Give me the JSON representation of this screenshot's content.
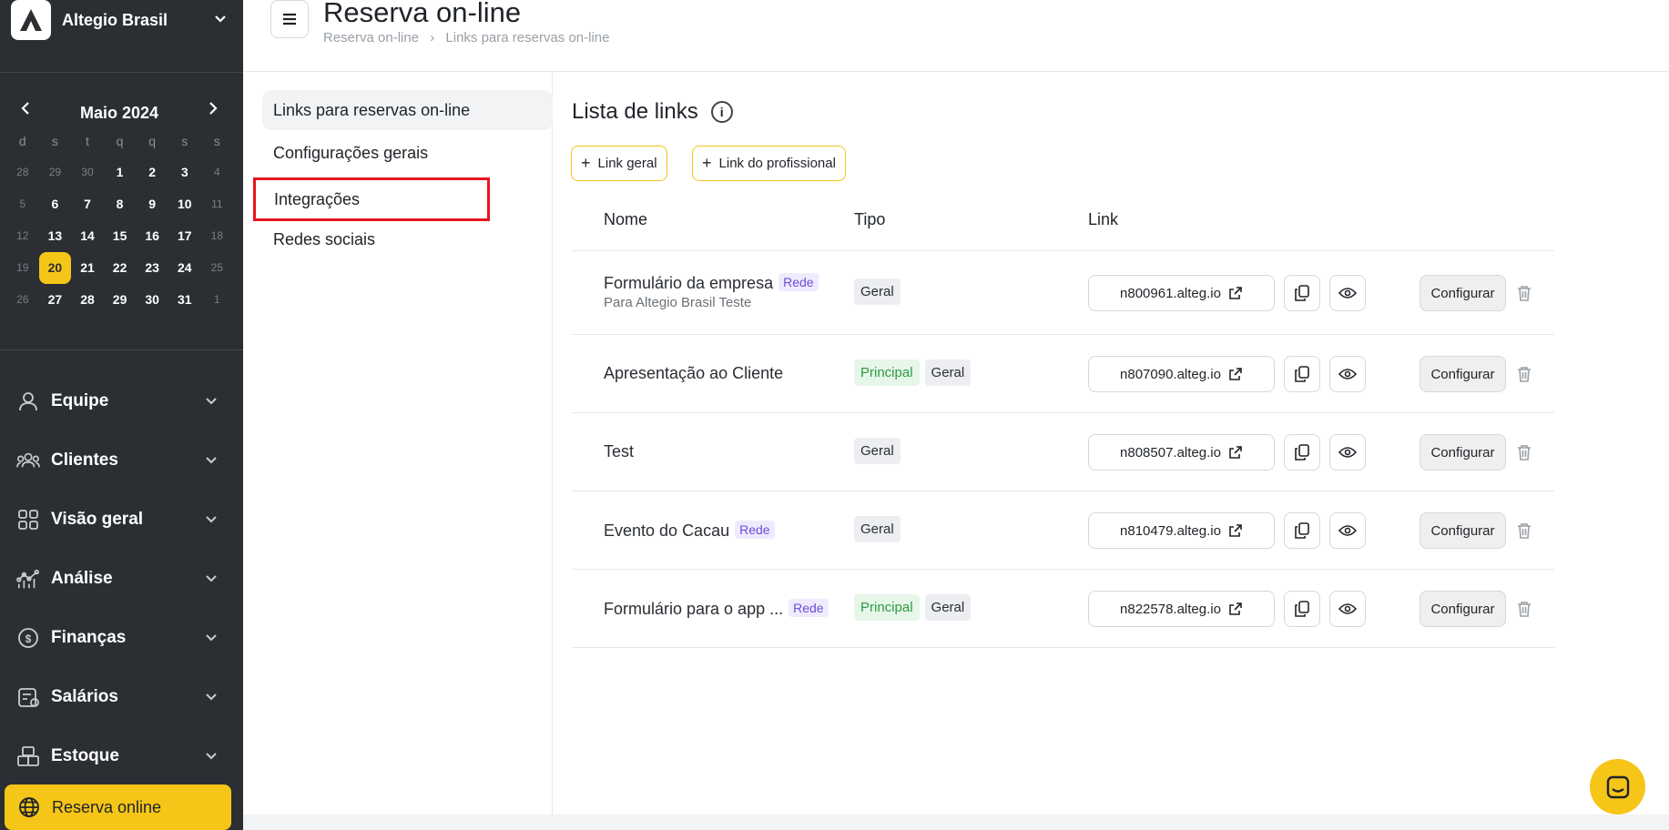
{
  "company": {
    "name": "Altegio Brasil",
    "logo_icon": "altegio-logo"
  },
  "calendar": {
    "title": "Maio 2024",
    "weekdays": [
      "d",
      "s",
      "t",
      "q",
      "q",
      "s",
      "s"
    ],
    "weeks": [
      [
        "28",
        "29",
        "30",
        "1",
        "2",
        "3",
        "4"
      ],
      [
        "5",
        "6",
        "7",
        "8",
        "9",
        "10",
        "11"
      ],
      [
        "12",
        "13",
        "14",
        "15",
        "16",
        "17",
        "18"
      ],
      [
        "19",
        "20",
        "21",
        "22",
        "23",
        "24",
        "25"
      ],
      [
        "26",
        "27",
        "28",
        "29",
        "30",
        "31",
        "1"
      ]
    ],
    "today": "20"
  },
  "nav": {
    "items": [
      {
        "label": "Equipe",
        "icon": "user-icon"
      },
      {
        "label": "Clientes",
        "icon": "users-icon"
      },
      {
        "label": "Visão geral",
        "icon": "grid-icon"
      },
      {
        "label": "Análise",
        "icon": "analytics-icon"
      },
      {
        "label": "Finanças",
        "icon": "finance-icon"
      },
      {
        "label": "Salários",
        "icon": "salary-icon"
      },
      {
        "label": "Estoque",
        "icon": "stock-icon"
      }
    ],
    "active": {
      "label": "Reserva online",
      "icon": "globe-icon"
    }
  },
  "header": {
    "title": "Reserva on-line",
    "breadcrumbs": [
      "Reserva on-line",
      "Links para reservas on-line"
    ]
  },
  "subnav": {
    "items": [
      "Links para reservas on-line",
      "Configurações gerais",
      "Integrações",
      "Redes sociais"
    ]
  },
  "main": {
    "title": "Lista de links",
    "buttons": {
      "general": "Link geral",
      "professional": "Link do profissional"
    },
    "columns": {
      "name": "Nome",
      "type": "Tipo",
      "link": "Link"
    },
    "rows": [
      {
        "name": "Formulário da empresa",
        "badge": "Rede",
        "subtitle": "Para Altegio Brasil Teste",
        "tags": [
          "Geral"
        ],
        "link": "n800961.alteg.io"
      },
      {
        "name": "Apresentação ao Cliente",
        "badge": "",
        "subtitle": "",
        "tags": [
          "Principal",
          "Geral"
        ],
        "link": "n807090.alteg.io"
      },
      {
        "name": "Test",
        "badge": "",
        "subtitle": "",
        "tags": [
          "Geral"
        ],
        "link": "n808507.alteg.io"
      },
      {
        "name": "Evento do Cacau",
        "badge": "Rede",
        "subtitle": "",
        "tags": [
          "Geral"
        ],
        "link": "n810479.alteg.io"
      },
      {
        "name": "Formulário para o app ...",
        "badge": "Rede",
        "subtitle": "",
        "tags": [
          "Principal",
          "Geral"
        ],
        "link": "n822578.alteg.io"
      }
    ],
    "configure_label": "Configurar"
  },
  "colors": {
    "accent": "#f5c518",
    "sidebar": "#2b2f33",
    "highlight": "#e8141d"
  }
}
